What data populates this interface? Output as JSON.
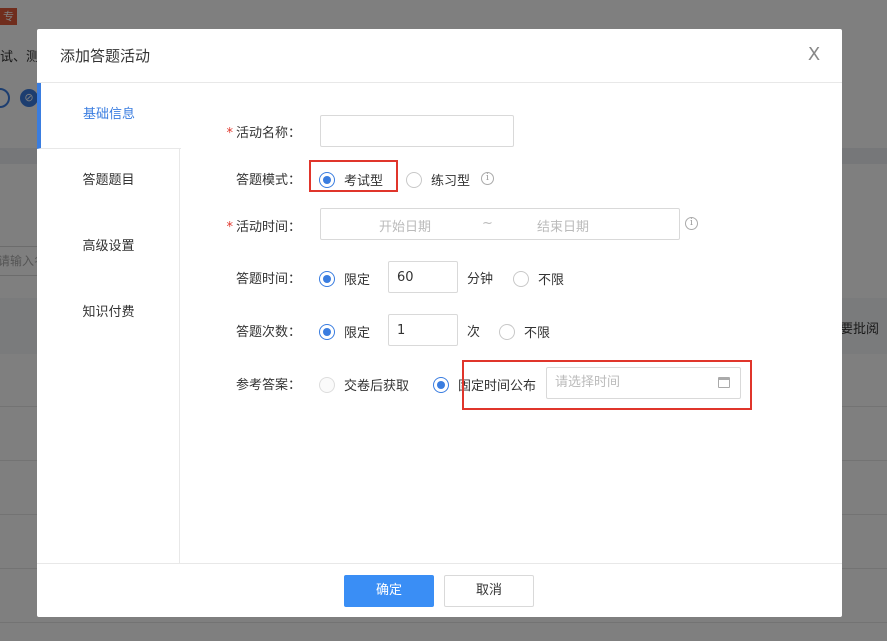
{
  "background": {
    "tag": "专",
    "text_line": "试、测",
    "search_placeholder": "请输入名",
    "column_label": "要批阅"
  },
  "dialog": {
    "title": "添加答题活动",
    "close_label": "X"
  },
  "sidebar": {
    "items": [
      {
        "label": "基础信息",
        "active": true
      },
      {
        "label": "答题题目"
      },
      {
        "label": "高级设置"
      },
      {
        "label": "知识付费"
      }
    ]
  },
  "form": {
    "name": {
      "label": "活动名称：",
      "value": ""
    },
    "mode": {
      "label": "答题模式：",
      "option_exam": "考试型",
      "option_practice": "练习型"
    },
    "time": {
      "label": "活动时间：",
      "start_placeholder": "开始日期",
      "separator": "~",
      "end_placeholder": "结束日期"
    },
    "duration": {
      "label": "答题时间：",
      "limited": "限定",
      "value": "60",
      "unit": "分钟",
      "unlimited": "不限"
    },
    "attempts": {
      "label": "答题次数：",
      "limited": "限定",
      "value": "1",
      "unit": "次",
      "unlimited": "不限"
    },
    "answer": {
      "label": "参考答案：",
      "option_after": "交卷后获取",
      "option_fixed": "固定时间公布",
      "time_placeholder": "请选择时间"
    }
  },
  "footer": {
    "confirm": "确定",
    "cancel": "取消"
  },
  "colors": {
    "accent": "#3a7de0",
    "primary_button": "#3a8ef5",
    "required": "#e0352b",
    "highlight_box": "#e0352b"
  }
}
